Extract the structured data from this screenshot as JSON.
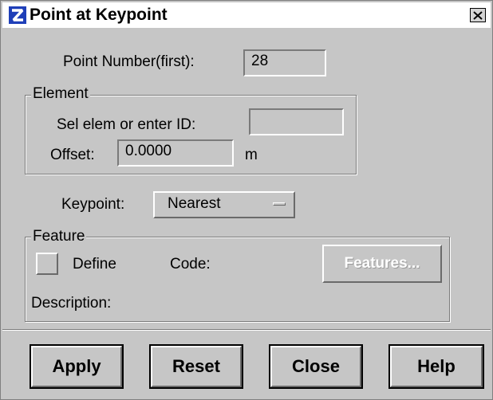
{
  "window": {
    "title": "Point at Keypoint",
    "app_icon": "app-logo-icon",
    "close_icon": "close-x-icon"
  },
  "point_number": {
    "label": "Point Number(first):",
    "value": "28"
  },
  "element": {
    "legend": "Element",
    "sel_label": "Sel elem or enter ID:",
    "sel_value": "",
    "offset_label": "Offset:",
    "offset_value": "0.0000",
    "offset_unit": "m"
  },
  "keypoint": {
    "label": "Keypoint:",
    "selected": "Nearest"
  },
  "feature": {
    "legend": "Feature",
    "define_label": "Define",
    "define_checked": false,
    "code_label": "Code:",
    "features_button": "Features...",
    "description_label": "Description:"
  },
  "buttons": {
    "apply": "Apply",
    "reset": "Reset",
    "close": "Close",
    "help": "Help"
  },
  "colors": {
    "dialog_bg": "#c6c6c6",
    "titlebar_bg": "#ffffff",
    "icon_blue": "#1f3fb8"
  }
}
